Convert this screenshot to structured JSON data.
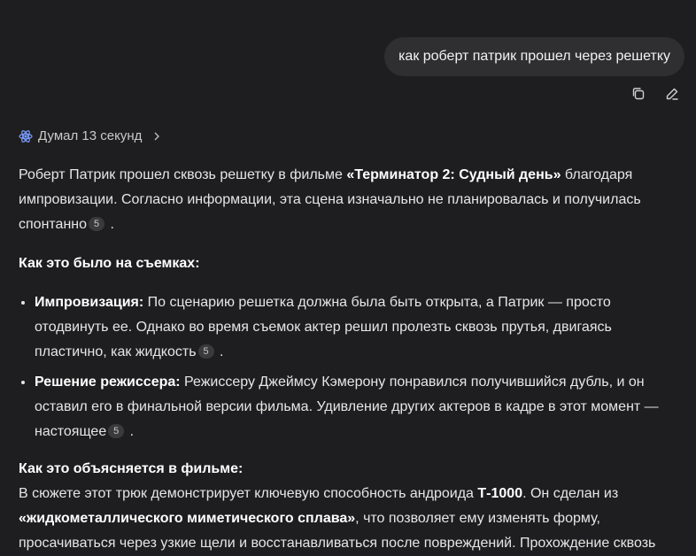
{
  "user_message": {
    "text": "как роберт патрик прошел через решетку"
  },
  "message_actions": {
    "copy_icon": "copy-icon",
    "edit_icon": "edit-icon"
  },
  "thinking": {
    "label": "Думал 13 секунд",
    "icon": "atom-icon"
  },
  "answer": {
    "intro": {
      "t1": "Роберт Патрик прошел сквозь решетку в фильме ",
      "bold1": "«Терминатор 2: Судный день»",
      "t2": " благодаря импровизации. Согласно информации, эта сцена изначально не планировалась и получилась спонтанно",
      "cite": "5",
      "t3": " ."
    },
    "section1_title": "Как это было на съемках:",
    "bullets": [
      {
        "bold": "Импровизация:",
        "text": " По сценарию решетка должна была быть открыта, а Патрик — просто отодвинуть ее. Однако во время съемок актер решил пролезть сквозь прутья, двигаясь пластично, как жидкость",
        "cite": "5",
        "end": " ."
      },
      {
        "bold": "Решение режиссера:",
        "text": " Режиссеру Джеймсу Кэмерону понравился получившийся дубль, и он оставил его в финальной версии фильма. Удивление других актеров в кадре в этот момент — настоящее",
        "cite": "5",
        "end": " ."
      }
    ],
    "section2_title": "Как это объясняется в фильме:",
    "section2": {
      "t1": "В сюжете этот трюк демонстрирует ключевую способность андроида ",
      "bold1": "Т-1000",
      "t2": ". Он сделан из ",
      "bold2": "«жидкометаллического миметического сплава»",
      "t3": ", что позволяет ему изменять форму, просачиваться через узкие щели и восстанавливаться после повреждений. Прохождение сквозь"
    }
  }
}
